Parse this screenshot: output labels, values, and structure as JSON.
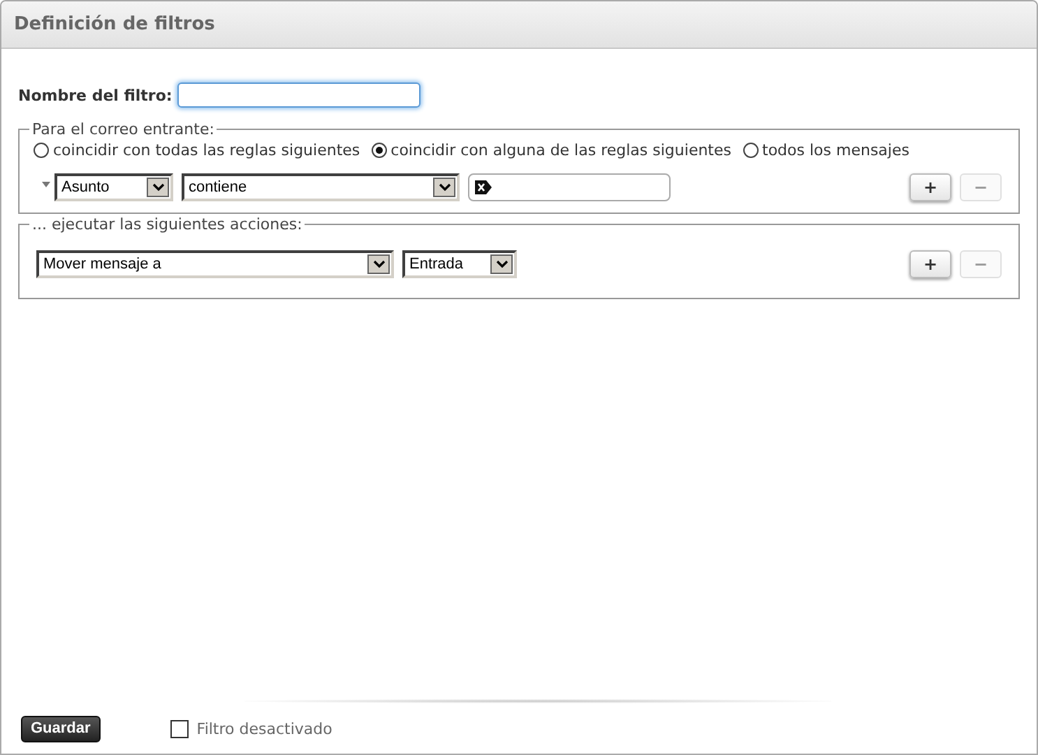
{
  "window": {
    "title": "Definición de filtros"
  },
  "filter_name": {
    "label": "Nombre del filtro:",
    "focused": true
  },
  "incoming": {
    "legend": "Para el correo entrante:",
    "match_options": [
      {
        "label": "coincidir con todas las reglas siguientes",
        "selected": false
      },
      {
        "label": "coincidir con alguna de las reglas siguientes",
        "selected": true
      },
      {
        "label": "todos los mensajes",
        "selected": false
      }
    ],
    "rules": [
      {
        "field": "Asunto",
        "operator": "contiene"
      }
    ],
    "buttons": [
      {
        "label": "+",
        "disabled": false
      },
      {
        "label": "−",
        "disabled": true
      }
    ]
  },
  "actions": {
    "legend": "... ejecutar las siguientes acciones:",
    "rows": [
      {
        "action": "Mover mensaje a",
        "target": "Entrada"
      }
    ],
    "buttons": [
      {
        "label": "+",
        "disabled": false
      },
      {
        "label": "−",
        "disabled": true
      }
    ]
  },
  "footer": {
    "save_button": "Guardar",
    "disable_checkbox": {
      "label": "Filtro desactivado",
      "checked": false
    }
  }
}
